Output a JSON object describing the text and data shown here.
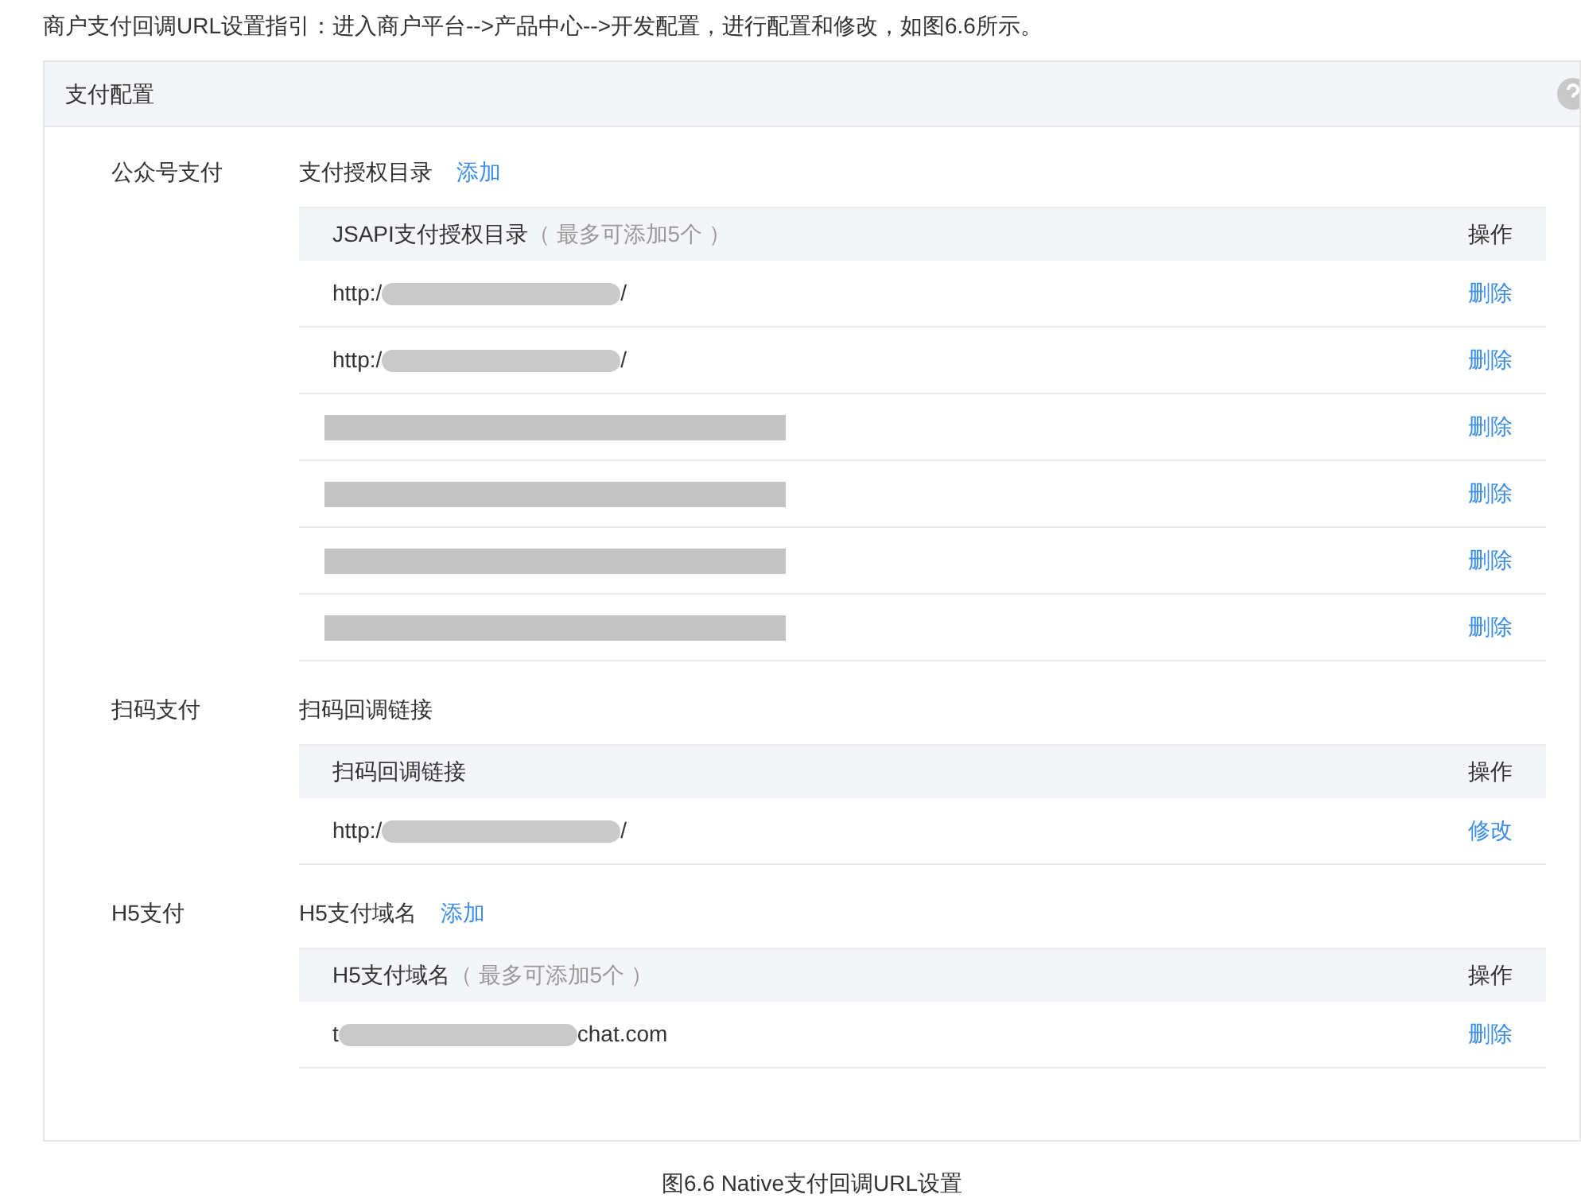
{
  "intro": "商户支付回调URL设置指引：进入商户平台-->产品中心-->开发配置，进行配置和修改，如图6.6所示。",
  "panel": {
    "title": "支付配置",
    "sections": [
      {
        "label": "公众号支付",
        "title": "支付授权目录",
        "add_link": "添加",
        "header": "JSAPI支付授权目录",
        "header_note": "（ 最多可添加5个 ）",
        "action_header": "操作",
        "rows": [
          {
            "kind": "partial",
            "prefix": "http:/",
            "suffix": "/",
            "action": "删除"
          },
          {
            "kind": "partial",
            "prefix": "http:/",
            "suffix": "/",
            "action": "删除"
          },
          {
            "kind": "hidden",
            "action": "删除"
          },
          {
            "kind": "hidden",
            "action": "删除"
          },
          {
            "kind": "hidden",
            "action": "删除"
          },
          {
            "kind": "hidden",
            "action": "删除"
          }
        ]
      },
      {
        "label": "扫码支付",
        "title": "扫码回调链接",
        "header": "扫码回调链接",
        "action_header": "操作",
        "rows": [
          {
            "kind": "partial",
            "prefix": "http:/",
            "suffix": "/",
            "action": "修改"
          }
        ]
      },
      {
        "label": "H5支付",
        "title": "H5支付域名",
        "add_link": "添加",
        "header": "H5支付域名",
        "header_note": "（ 最多可添加5个 ）",
        "action_header": "操作",
        "rows": [
          {
            "kind": "partial",
            "prefix": "t",
            "suffix": "chat.com",
            "action": "删除"
          }
        ]
      }
    ]
  },
  "caption": "图6.6 Native支付回调URL设置"
}
